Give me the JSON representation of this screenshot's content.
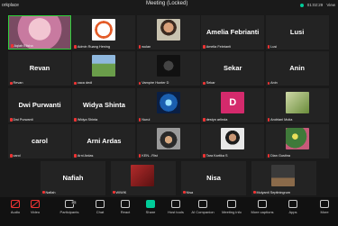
{
  "app": {
    "name": "orkplace"
  },
  "window": {
    "title": "Meeting (Locked)"
  },
  "statusbar": {
    "time": "01:02:29",
    "view": "View"
  },
  "participants": [
    {
      "name": "",
      "label": "Aqiah Elisha",
      "active": true,
      "photo": "pink"
    },
    {
      "name": "",
      "label": "Admin Ruang Hening",
      "photo": "logo"
    },
    {
      "name": "",
      "label": "wulan",
      "photo": "portrait"
    },
    {
      "name": "Amelia Febrianti",
      "label": "Amelia Febrianti"
    },
    {
      "name": "Lusi",
      "label": "Lusi"
    },
    {
      "name": "Revan",
      "label": "Revan"
    },
    {
      "name": "",
      "label": "caca dedi",
      "photo": "landscape"
    },
    {
      "name": "",
      "label": "Vampire Hunter D",
      "photo": "dark"
    },
    {
      "name": "Sekar",
      "label": "Sekar"
    },
    {
      "name": "Anin",
      "label": "Anin"
    },
    {
      "name": "Dwi Purwanti",
      "label": "Dwi Purwanti"
    },
    {
      "name": "Widya Shinta",
      "label": "Widya Shinta"
    },
    {
      "name": "",
      "label": "Nurul",
      "photo": "blue"
    },
    {
      "name": "",
      "label": "destyn arlinda",
      "photo": "letter",
      "letter": "D"
    },
    {
      "name": "",
      "label": "Andriani Mutia",
      "photo": "plant"
    },
    {
      "name": "carol",
      "label": "carol"
    },
    {
      "name": "Arni Ardas",
      "label": "Arni Ardas"
    },
    {
      "name": "",
      "label": "KEN...Rist",
      "photo": "hijab"
    },
    {
      "name": "",
      "label": "Tara Kartika S",
      "photo": "person"
    },
    {
      "name": "",
      "label": "Dian Gustina",
      "photo": "flowers"
    },
    {
      "name": "Nafiah",
      "label": "Nafiah"
    },
    {
      "name": "",
      "label": "WIWIK",
      "photo": "red"
    },
    {
      "name": "Nisa",
      "label": "Nisa"
    },
    {
      "name": "",
      "label": "Mulyanti Septiningrum",
      "photo": "room"
    }
  ],
  "toolbar": {
    "audio": "Audio",
    "video": "Video",
    "participants": "Participants",
    "participants_count": "83",
    "chat": "Chat",
    "react": "React",
    "share": "Share",
    "host_tools": "Host tools",
    "ai_companion": "AI Companion",
    "meeting_info": "Meeting info",
    "more": "More captions",
    "apps": "Apps",
    "leave": "More"
  }
}
